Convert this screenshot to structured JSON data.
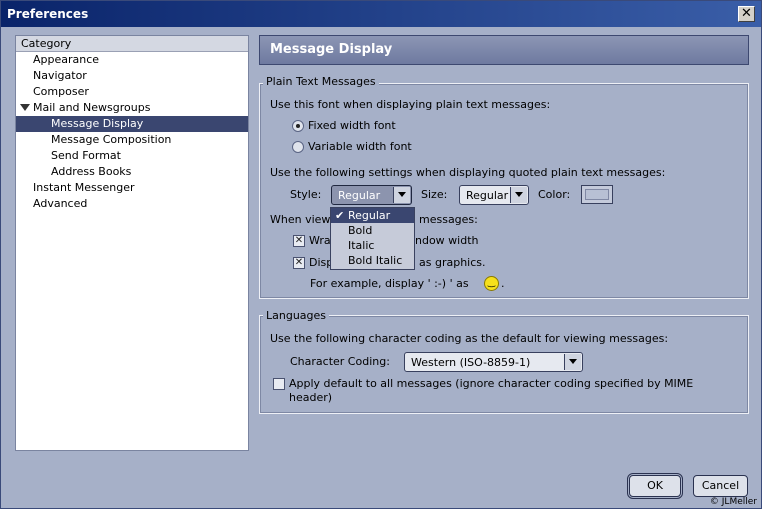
{
  "window": {
    "title": "Preferences",
    "close_glyph": "✕"
  },
  "tree": {
    "header": "Category",
    "items": [
      {
        "label": "Appearance",
        "level": 0,
        "state": "collapsed"
      },
      {
        "label": "Navigator",
        "level": 0,
        "state": "collapsed"
      },
      {
        "label": "Composer",
        "level": 0,
        "state": "collapsed"
      },
      {
        "label": "Mail and Newsgroups",
        "level": 0,
        "state": "expanded"
      },
      {
        "label": "Message Display",
        "level": 1,
        "selected": true
      },
      {
        "label": "Message Composition",
        "level": 1
      },
      {
        "label": "Send Format",
        "level": 1
      },
      {
        "label": "Address Books",
        "level": 1
      },
      {
        "label": "Instant Messenger",
        "level": 0,
        "state": "collapsed"
      },
      {
        "label": "Advanced",
        "level": 0,
        "state": "collapsed"
      }
    ]
  },
  "panel": {
    "title": "Message Display"
  },
  "plain_text": {
    "legend": "Plain Text Messages",
    "font_intro": "Use this font when displaying plain text messages:",
    "radio_fixed": "Fixed width font",
    "radio_variable": "Variable width font",
    "quoted_intro": "Use the following settings when displaying quoted plain text messages:",
    "style_label": "Style:",
    "style_value": "Regular",
    "size_label": "Size:",
    "size_value": "Regular",
    "color_label": "Color:",
    "view_intro_a": "When view",
    "view_intro_b": "messages:",
    "wrap_a": "Wra",
    "wrap_b": "ndow width",
    "display_a": "Disp",
    "display_b": "as graphics.",
    "example": "For example, display ' :-) ' as"
  },
  "style_options": [
    "Regular",
    "Bold",
    "Italic",
    "Bold Italic"
  ],
  "languages": {
    "legend": "Languages",
    "intro": "Use the following character coding as the default for viewing messages:",
    "coding_label": "Character Coding:",
    "coding_value": "Western (ISO-8859-1)",
    "apply_line1": "Apply default to all messages (ignore character coding specified by MIME",
    "apply_line2": "header)"
  },
  "buttons": {
    "ok": "OK",
    "cancel": "Cancel"
  },
  "credit": "© JLMeller",
  "colors": {
    "accent": "#3a4670",
    "background": "#a6b0c8",
    "titlebar": "#0a246a"
  }
}
